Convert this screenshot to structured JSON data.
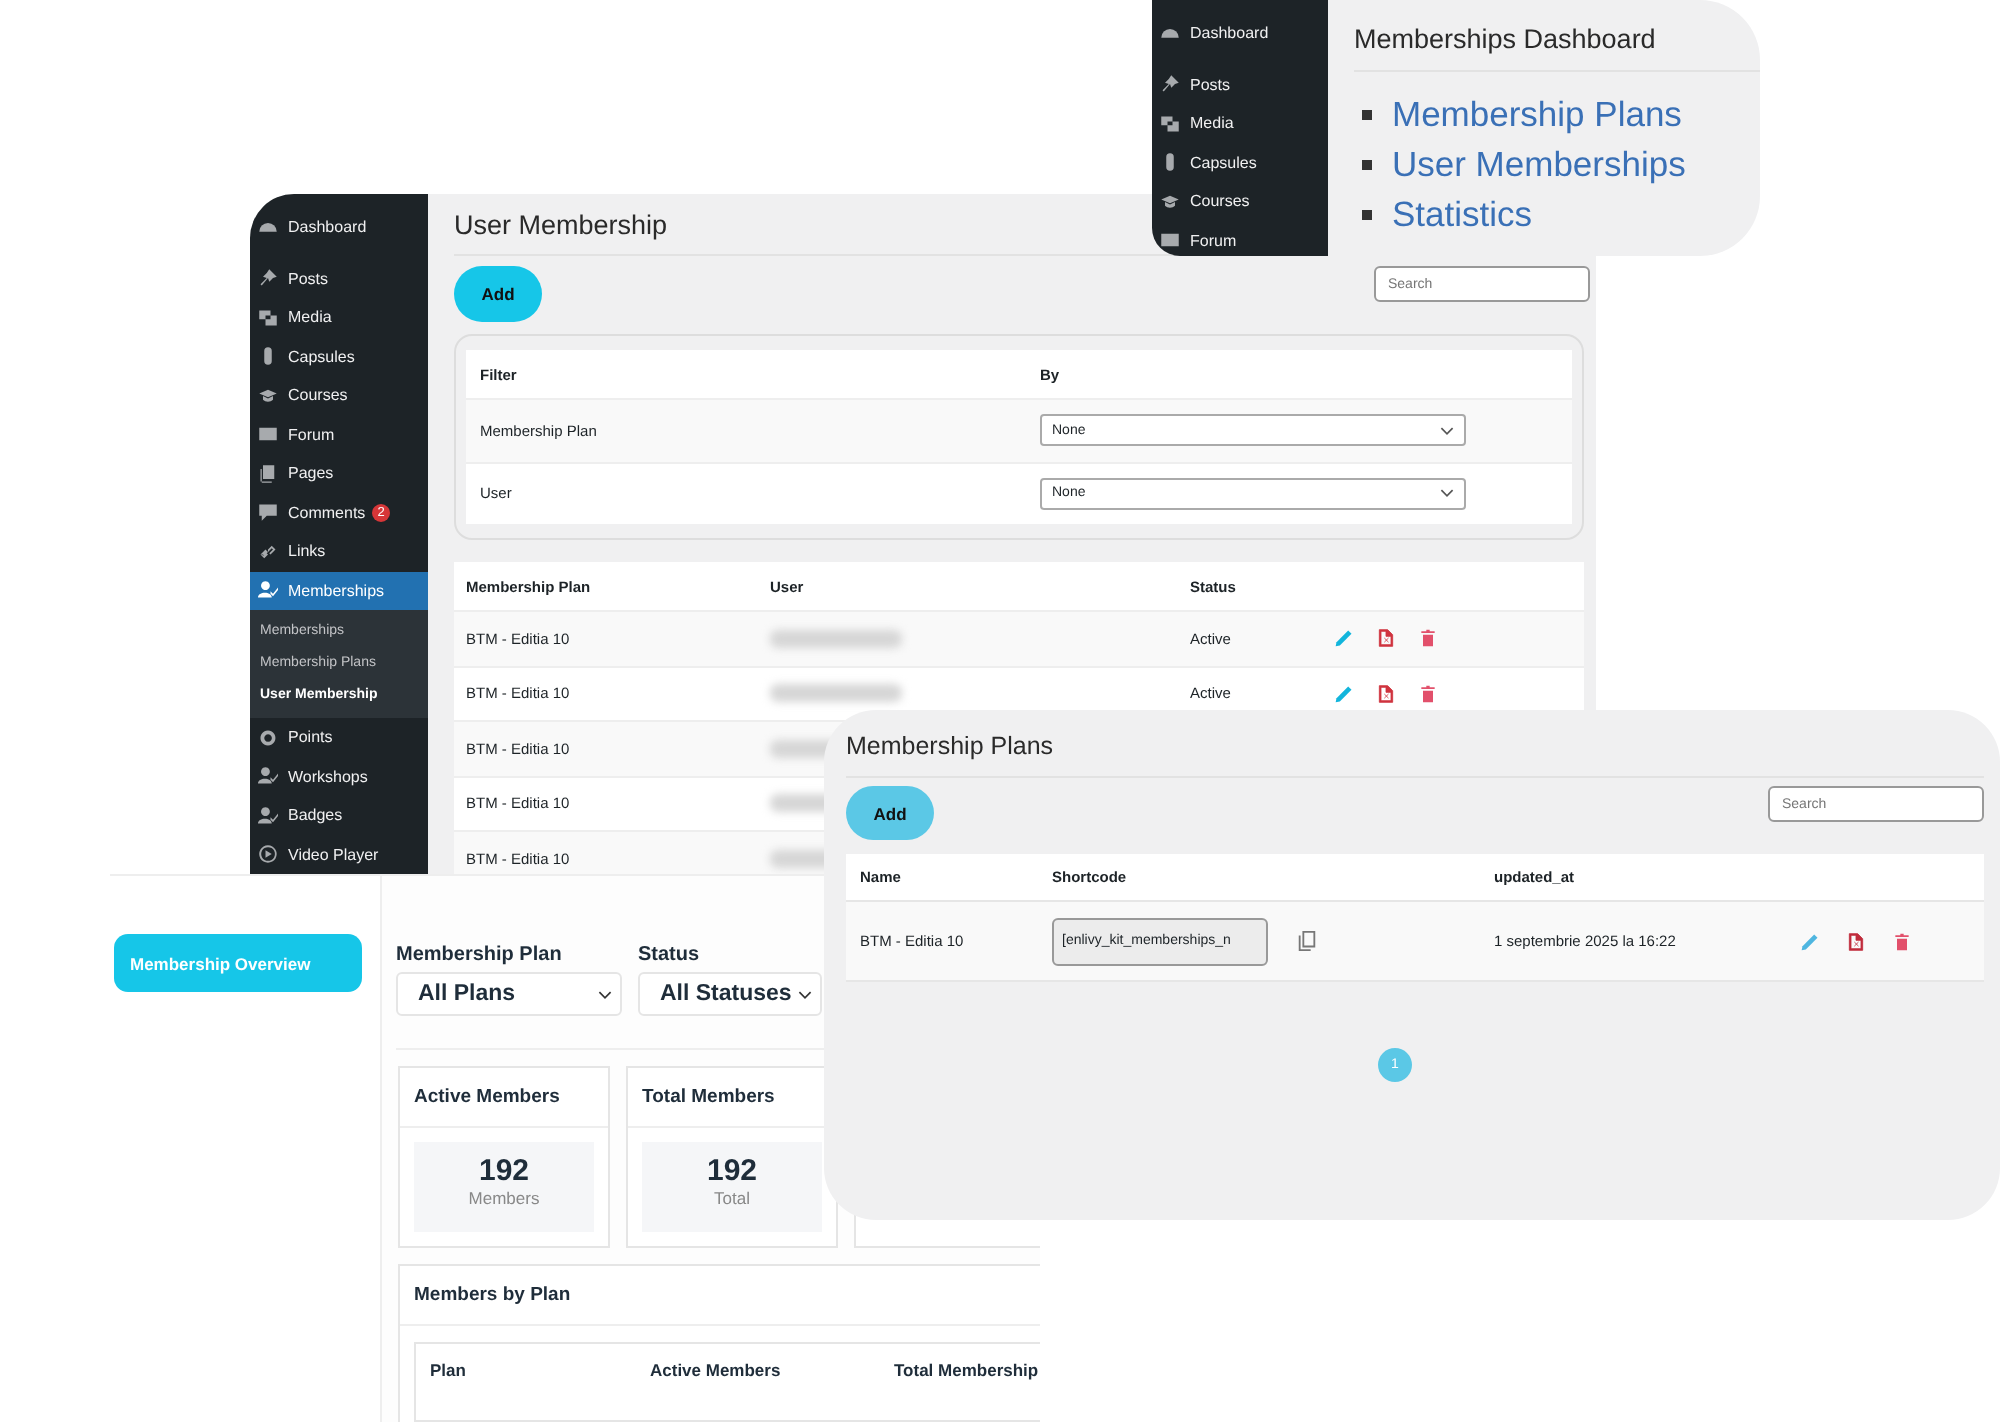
{
  "dashboard_window": {
    "menu": [
      {
        "label": "Dashboard"
      },
      {
        "label": "Posts"
      },
      {
        "label": "Media"
      },
      {
        "label": "Capsules"
      },
      {
        "label": "Courses"
      },
      {
        "label": "Forum"
      }
    ],
    "title": "Memberships Dashboard",
    "links": [
      "Membership Plans",
      "User Memberships",
      "Statistics"
    ]
  },
  "user_membership_window": {
    "menu": [
      {
        "label": "Dashboard",
        "selected": false
      },
      {
        "label": "Posts",
        "selected": false
      },
      {
        "label": "Media",
        "selected": false
      },
      {
        "label": "Capsules",
        "selected": false
      },
      {
        "label": "Courses",
        "selected": false
      },
      {
        "label": "Forum",
        "selected": false
      },
      {
        "label": "Pages",
        "selected": false
      },
      {
        "label": "Comments",
        "selected": false,
        "count": "2"
      },
      {
        "label": "Links",
        "selected": false
      },
      {
        "label": "Memberships",
        "selected": true,
        "expanded": true,
        "children": [
          {
            "label": "Memberships",
            "selected": false
          },
          {
            "label": "Membership Plans",
            "selected": false
          },
          {
            "label": "User Membership",
            "selected": true
          }
        ]
      },
      {
        "label": "Points",
        "selected": false
      },
      {
        "label": "Workshops",
        "selected": false
      },
      {
        "label": "Badges",
        "selected": false
      },
      {
        "label": "Video Player",
        "selected": false
      }
    ],
    "title": "User Membership",
    "add_button": "Add",
    "search": {
      "placeholder": "Search"
    },
    "filter": {
      "columns": [
        "Filter",
        "By"
      ],
      "rows": [
        {
          "label": "Membership Plan",
          "value": "None"
        },
        {
          "label": "User",
          "value": "None"
        }
      ]
    },
    "table": {
      "columns": [
        "Membership Plan",
        "User",
        "Status"
      ],
      "rows": [
        {
          "membership_plan": "BTM - Editia 10",
          "status": "Active"
        },
        {
          "membership_plan": "BTM - Editia 10",
          "status": "Active"
        },
        {
          "membership_plan": "BTM - Editia 10"
        },
        {
          "membership_plan": "BTM - Editia 10"
        },
        {
          "membership_plan": "BTM - Editia 10"
        }
      ]
    }
  },
  "overview": {
    "nav": [
      {
        "label": "Membership Overview",
        "selected": true
      }
    ],
    "filters": [
      {
        "label": "Membership Plan",
        "value": "All Plans"
      },
      {
        "label": "Status",
        "value": "All Statuses"
      }
    ],
    "cards": [
      {
        "title": "Active Members",
        "value": "192",
        "unit": "Members"
      },
      {
        "title": "Total Members",
        "value": "192",
        "unit": "Total"
      }
    ],
    "members_by_plan": {
      "title": "Members by Plan",
      "columns": [
        "Plan",
        "Active Members",
        "Total Membership"
      ]
    }
  },
  "membership_plans_window": {
    "title": "Membership Plans",
    "add_button": "Add",
    "search": {
      "placeholder": "Search"
    },
    "table": {
      "columns": [
        "Name",
        "Shortcode",
        "updated_at"
      ],
      "rows": [
        {
          "name": "BTM - Editia 10",
          "shortcode": "[enlivy_kit_memberships_n",
          "updated_at": "1 septembrie 2025 la 16:22"
        }
      ]
    },
    "pages": [
      {
        "label": "1",
        "selected": true
      }
    ]
  }
}
